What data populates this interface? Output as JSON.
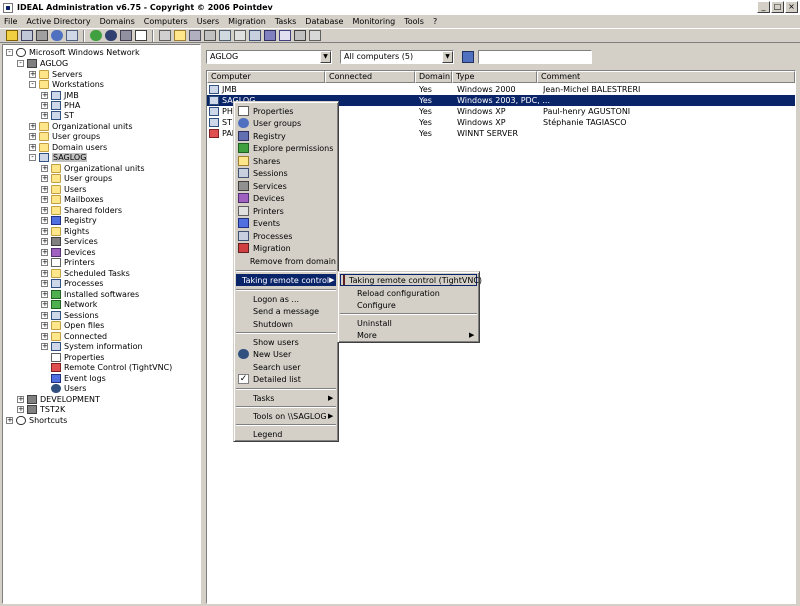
{
  "window": {
    "title": "IDEAL Administration v6.75 - Copyright © 2006 Pointdev",
    "minimize": "_",
    "maximize": "□",
    "close": "×"
  },
  "menubar": [
    "File",
    "Active Directory",
    "Domains",
    "Computers",
    "Users",
    "Migration",
    "Tasks",
    "Database",
    "Monitoring",
    "Tools",
    "?"
  ],
  "tree": {
    "root": "Microsoft Windows Network",
    "aglog": "AGLOG",
    "servers": "Servers",
    "workstations": "Workstations",
    "jmb": "JMB",
    "pha": "PHA",
    "st": "ST",
    "org_units": "Organizational units",
    "user_groups": "User groups",
    "domain_users": "Domain users",
    "saglog": "SAGLOG",
    "saglog_children": [
      "Organizational units",
      "User groups",
      "Users",
      "Mailboxes",
      "Shared folders",
      "Registry",
      "Rights",
      "Services",
      "Devices",
      "Printers",
      "Scheduled Tasks",
      "Processes",
      "Installed softwares",
      "Network",
      "Sessions",
      "Open files",
      "Connected",
      "System information",
      "Properties",
      "Remote Control (TightVNC)",
      "Event logs",
      "Users"
    ],
    "development": "DEVELOPMENT",
    "tst2k": "TST2K",
    "shortcuts": "Shortcuts"
  },
  "filters": {
    "domain": "AGLOG",
    "computers": "All computers (5)",
    "search": ""
  },
  "list": {
    "columns": [
      "Computer",
      "Connected",
      "Domain",
      "Type",
      "Comment"
    ],
    "rows": [
      {
        "computer": "JMB",
        "connected": "",
        "domain": "Yes",
        "type": "Windows 2000",
        "comment": "Jean-Michel BALESTRERI"
      },
      {
        "computer": "SAGLOG",
        "connected": "",
        "domain": "Yes",
        "type": "Windows 2003, PDC, ...",
        "comment": ""
      },
      {
        "computer": "PHA",
        "connected": "",
        "domain": "Yes",
        "type": "Windows XP",
        "comment": "Paul-henry AGUSTONI"
      },
      {
        "computer": "ST",
        "connected": "",
        "domain": "Yes",
        "type": "Windows XP",
        "comment": "Stéphanie TAGIASCO"
      },
      {
        "computer": "PAI",
        "connected": "",
        "domain": "Yes",
        "type": "WINNT SERVER",
        "comment": ""
      }
    ]
  },
  "context_menu": {
    "group1": [
      "Properties",
      "User groups",
      "Registry",
      "Explore permissions",
      "Shares",
      "Sessions",
      "Services",
      "Devices",
      "Printers",
      "Events",
      "Processes",
      "Migration",
      "Remove from domain"
    ],
    "remote_control": "Taking remote control",
    "group2": [
      "Logon as ...",
      "Send a message",
      "Shutdown"
    ],
    "group3": [
      "Show users",
      "New User",
      "Search user",
      "Detailed list"
    ],
    "tasks": "Tasks",
    "tools_on": "Tools on \\\\SAGLOG",
    "legend": "Legend"
  },
  "submenu": {
    "take_control": "Taking remote control (TightVNC)",
    "reload": "Reload configuration",
    "configure": "Configure",
    "uninstall": "Uninstall",
    "more": "More"
  },
  "colors": {
    "selection": "#0a246a",
    "face": "#d4d0c8"
  }
}
